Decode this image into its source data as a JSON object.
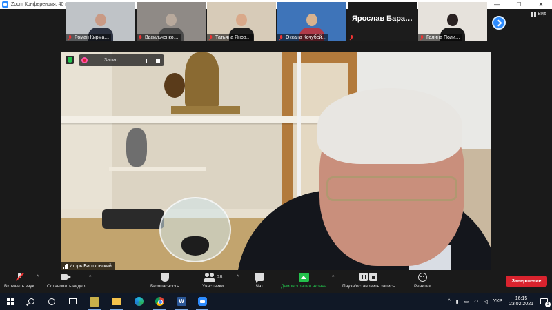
{
  "window": {
    "title": "Zoom Конференция, 40 мин",
    "controls": [
      "—",
      "☐",
      "✕"
    ]
  },
  "gallery": {
    "view_label": "Вид",
    "participants": [
      {
        "name": "Роман Кирма…",
        "muted": true,
        "video": true
      },
      {
        "name": "Васильченко…",
        "muted": true,
        "video": true
      },
      {
        "name": "Татьяна Янов…",
        "muted": true,
        "video": true
      },
      {
        "name": "Оксана Кочубей…",
        "muted": true,
        "video": true
      },
      {
        "name": "Ярослав Бара…",
        "muted": true,
        "video": false
      },
      {
        "name": "Галина Поли…",
        "muted": true,
        "video": true
      }
    ]
  },
  "recording": {
    "label": "Запис…"
  },
  "speaker": {
    "name": "Игорь Бартковский"
  },
  "toolbar": {
    "mute_label": "Включить звук",
    "video_label": "Остановить видео",
    "security_label": "Безопасность",
    "participants_label": "Участники",
    "participants_count": "28",
    "chat_label": "Чат",
    "share_label": "Демонстрация экрана",
    "record_label": "Пауза/остановить запись",
    "reactions_label": "Реакции",
    "end_label": "Завершение"
  },
  "taskbar": {
    "word_letter": "W",
    "language": "УКР",
    "time": "16:15",
    "date": "23.02.2021",
    "notifications": "1"
  },
  "colors": {
    "accent": "#2d8cff",
    "share_green": "#23c14c",
    "end_red": "#d9232e",
    "muted_red": "#e33333"
  }
}
